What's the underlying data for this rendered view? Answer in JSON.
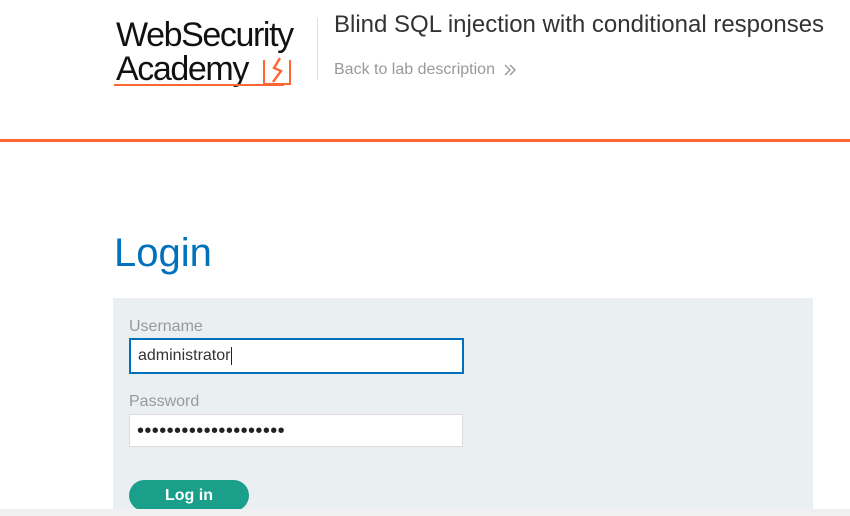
{
  "header": {
    "logo": {
      "line1": "WebSecurity",
      "line2": "Academy"
    },
    "lab_title": "Blind SQL injection with conditional responses",
    "back_link": "Back to lab description"
  },
  "colors": {
    "accent_orange": "#ff6633",
    "title_blue": "#0071bc",
    "button_green": "#1a9f8a",
    "panel_bg": "#eaeff2"
  },
  "login": {
    "title": "Login",
    "username_label": "Username",
    "username_value": "administrator",
    "password_label": "Password",
    "password_masked": "••••••••••••••••••••",
    "submit_label": "Log in"
  }
}
